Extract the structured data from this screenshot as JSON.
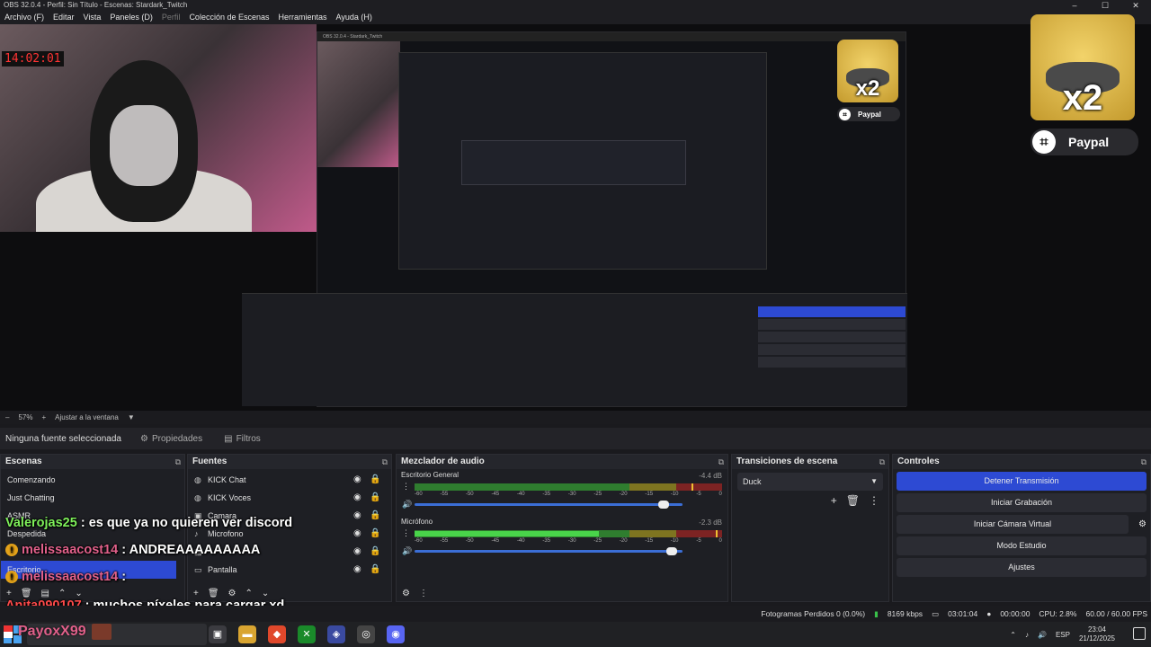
{
  "window": {
    "title": "OBS 32.0.4 - Perfil: Sin Título - Escenas: Stardark_Twitch",
    "controls": [
      "–",
      "☐",
      "✕"
    ]
  },
  "menu": [
    {
      "label": "Archivo (F)",
      "disabled": false
    },
    {
      "label": "Editar",
      "disabled": false
    },
    {
      "label": "Vista",
      "disabled": false
    },
    {
      "label": "Paneles (D)",
      "disabled": false
    },
    {
      "label": "Perfil",
      "disabled": true
    },
    {
      "label": "Colección de Escenas",
      "disabled": false
    },
    {
      "label": "Herramientas",
      "disabled": false
    },
    {
      "label": "Ayuda (H)",
      "disabled": false
    }
  ],
  "preview": {
    "webcam_clock": "14:02:01",
    "sticker": {
      "text": "x2",
      "paypal_label": "Paypal",
      "qr": "⌗"
    },
    "nested_title": "OBS 32.0.4 - Stardark_Twitch"
  },
  "toolbar": {
    "zoom": "57%",
    "fit": "Ajustar a la ventana"
  },
  "sourcebar": {
    "selection": "Ninguna fuente seleccionada",
    "properties": "Propiedades",
    "filters": "Filtros"
  },
  "scenes": {
    "title": "Escenas",
    "items": [
      "Comenzando",
      "Just Chatting",
      "ASMR",
      "Despedida",
      "",
      "Escritorio"
    ],
    "selected_index": 5
  },
  "sources": {
    "title": "Fuentes",
    "items": [
      {
        "label": "KICK Chat",
        "icon": "globe"
      },
      {
        "label": "KICK Voces",
        "icon": "globe"
      },
      {
        "label": "Camara",
        "icon": "camera"
      },
      {
        "label": "Microfono",
        "icon": "mic"
      },
      {
        "label": "",
        "icon": "image"
      },
      {
        "label": "Pantalla",
        "icon": "monitor"
      }
    ]
  },
  "mixer": {
    "title": "Mezclador de audio",
    "ticks": [
      "-60",
      "-55",
      "-50",
      "-45",
      "-40",
      "-35",
      "-30",
      "-25",
      "-20",
      "-15",
      "-10",
      "-5",
      "0"
    ],
    "channels": [
      {
        "name": "Escritorio General",
        "db": "-4.4 dB",
        "level": 0.0,
        "peak": 0.9,
        "volume": 0.95
      },
      {
        "name": "Micrófono",
        "db": "-2.3 dB",
        "level": 0.6,
        "peak": 0.98,
        "volume": 0.98
      }
    ]
  },
  "transitions": {
    "title": "Transiciones de escena",
    "current": "Duck"
  },
  "controls": {
    "title": "Controles",
    "buttons": [
      "Detener Transmisión",
      "Iniciar Grabación",
      "Iniciar Cámara Virtual",
      "Modo Estudio",
      "Ajustes"
    ]
  },
  "status": {
    "dropped": "Fotogramas Perdidos 0 (0.0%)",
    "bitrate": "8169 kbps",
    "stream_time": "03:01:04",
    "rec_time": "00:00:00",
    "cpu": "CPU: 2.8%",
    "fps": "60.00 / 60.00 FPS"
  },
  "chat": [
    {
      "user": "Valerojas25",
      "msg": ": es que ya no quieren ver discord",
      "class": "user1"
    },
    {
      "user": "melissaacost14",
      "msg": ": ANDREAAAAAAAAA",
      "class": "user2"
    },
    {
      "user": "melissaacost14",
      "msg": ":",
      "class": "user2"
    },
    {
      "user": "Anita090107",
      "msg": ": muchos píxeles para cargar xd",
      "class": "user3"
    }
  ],
  "overlay_user": "PayoxX99",
  "taskbar": {
    "lang": "ESP",
    "time": "23:04",
    "date": "21/12/2025"
  }
}
